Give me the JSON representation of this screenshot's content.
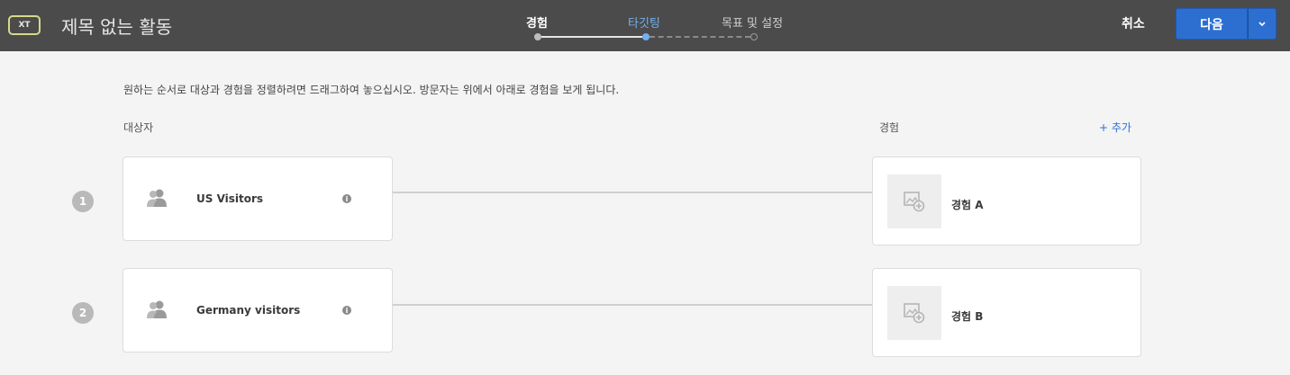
{
  "header": {
    "badge": "XT",
    "title": "제목 없는 활동",
    "steps": [
      {
        "label": "경험"
      },
      {
        "label": "타깃팅"
      },
      {
        "label": "목표 및 설정"
      }
    ],
    "cancel_label": "취소",
    "next_label": "다음"
  },
  "main": {
    "instruction": "원하는 순서로 대상과 경험을 정렬하려면 드래그하여 놓으십시오. 방문자는 위에서 아래로 경험을 보게 됩니다.",
    "audience_heading": "대상자",
    "experience_heading": "경험",
    "add_label": "+ 추가",
    "rows": [
      {
        "number": "1",
        "audience": "US Visitors",
        "experience": "경험 A"
      },
      {
        "number": "2",
        "audience": "Germany visitors",
        "experience": "경험 B"
      }
    ]
  },
  "colors": {
    "accent": "#2d6fd1",
    "topbar": "#4b4b4b",
    "active_step": "#74b0f0"
  }
}
